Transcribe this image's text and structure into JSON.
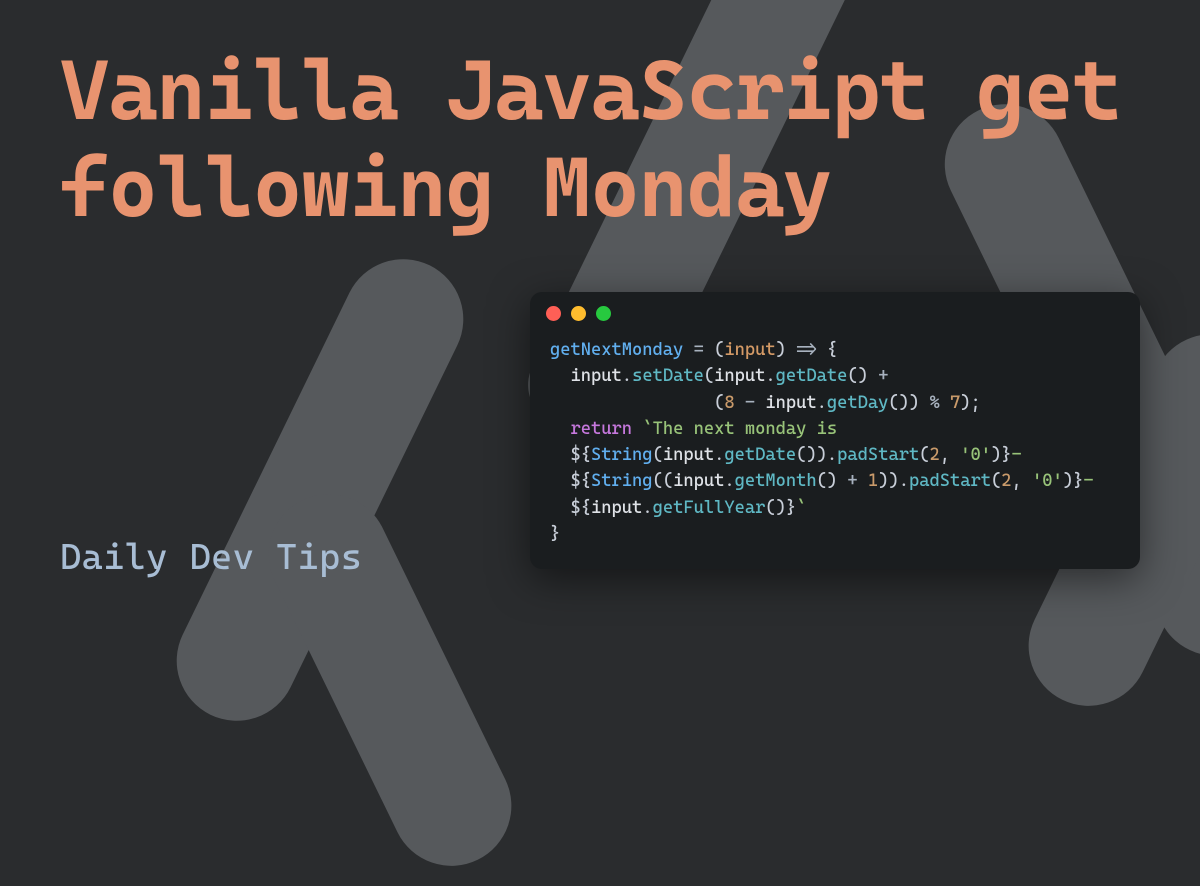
{
  "title": "Vanilla JavaScript get following Monday",
  "subtitle": "Daily Dev Tips",
  "colors": {
    "background": "#2a2c2e",
    "shape": "#56595c",
    "title": "#e8936f",
    "subtitle": "#a8bdd4",
    "code_bg": "#1a1d1f"
  },
  "code": {
    "function_name": "getNextMonday",
    "param": "input",
    "tokens": {
      "arrow": "=>",
      "set_date": "setDate",
      "get_date": "getDate",
      "get_day": "getDay",
      "get_month": "getMonth",
      "get_full_year": "getFullYear",
      "pad_start": "padStart",
      "string_ctor": "String",
      "return_kw": "return",
      "str_open": "`The next monday is",
      "eight": "8",
      "seven": "7",
      "two": "2",
      "one": "1",
      "zero_pad": "'0'",
      "dash": "-"
    }
  }
}
